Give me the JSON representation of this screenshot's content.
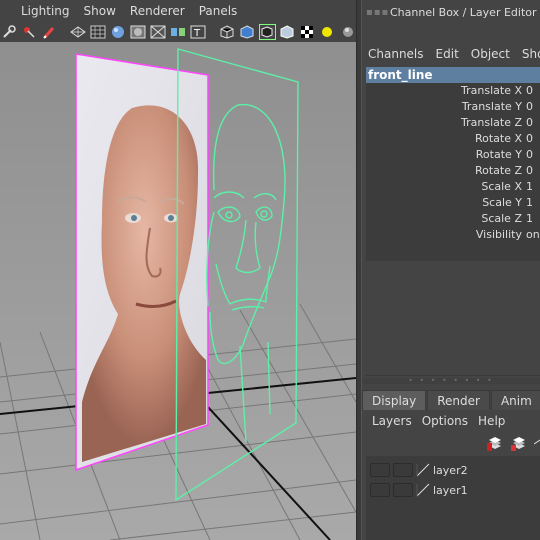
{
  "viewport": {
    "menus": [
      "Lighting",
      "Show",
      "Renderer",
      "Panels"
    ],
    "toolbar_icons": [
      "wrench-icon",
      "pin-icon",
      "brush-icon",
      "wireframe-icon",
      "grid-icon",
      "smooth-shade-icon",
      "flat-shade-icon",
      "wire-on-shaded-icon",
      "xray-icon",
      "texture-icon",
      "isolate-cube-icon",
      "shaded-cube-icon",
      "bbox-cube-icon",
      "cube-icon",
      "checker-icon",
      "light-bulb-icon",
      "shadow-sphere-icon"
    ],
    "toolbar_text_icon": "T",
    "colors": {
      "background": "#9e9e9e",
      "grid": "#7a7a7a",
      "axis": "#000000",
      "image_plane_frame": "#ff44ff",
      "curve": "#5cf0a8"
    }
  },
  "panel": {
    "title": "Channel Box / Layer Editor",
    "channel_box_menus": [
      "Channels",
      "Edit",
      "Object",
      "Show"
    ],
    "object_name": "front_line",
    "attributes": [
      {
        "name": "Translate X",
        "value": "0"
      },
      {
        "name": "Translate Y",
        "value": "0"
      },
      {
        "name": "Translate Z",
        "value": "0"
      },
      {
        "name": "Rotate X",
        "value": "0"
      },
      {
        "name": "Rotate Y",
        "value": "0"
      },
      {
        "name": "Rotate Z",
        "value": "0"
      },
      {
        "name": "Scale X",
        "value": "1"
      },
      {
        "name": "Scale Y",
        "value": "1"
      },
      {
        "name": "Scale Z",
        "value": "1"
      },
      {
        "name": "Visibility",
        "value": "on"
      }
    ],
    "layer_tabs": [
      "Display",
      "Render",
      "Anim"
    ],
    "active_tab": "Display",
    "layer_menus": [
      "Layers",
      "Options",
      "Help"
    ],
    "layers": [
      {
        "name": "layer2"
      },
      {
        "name": "layer1"
      }
    ]
  }
}
